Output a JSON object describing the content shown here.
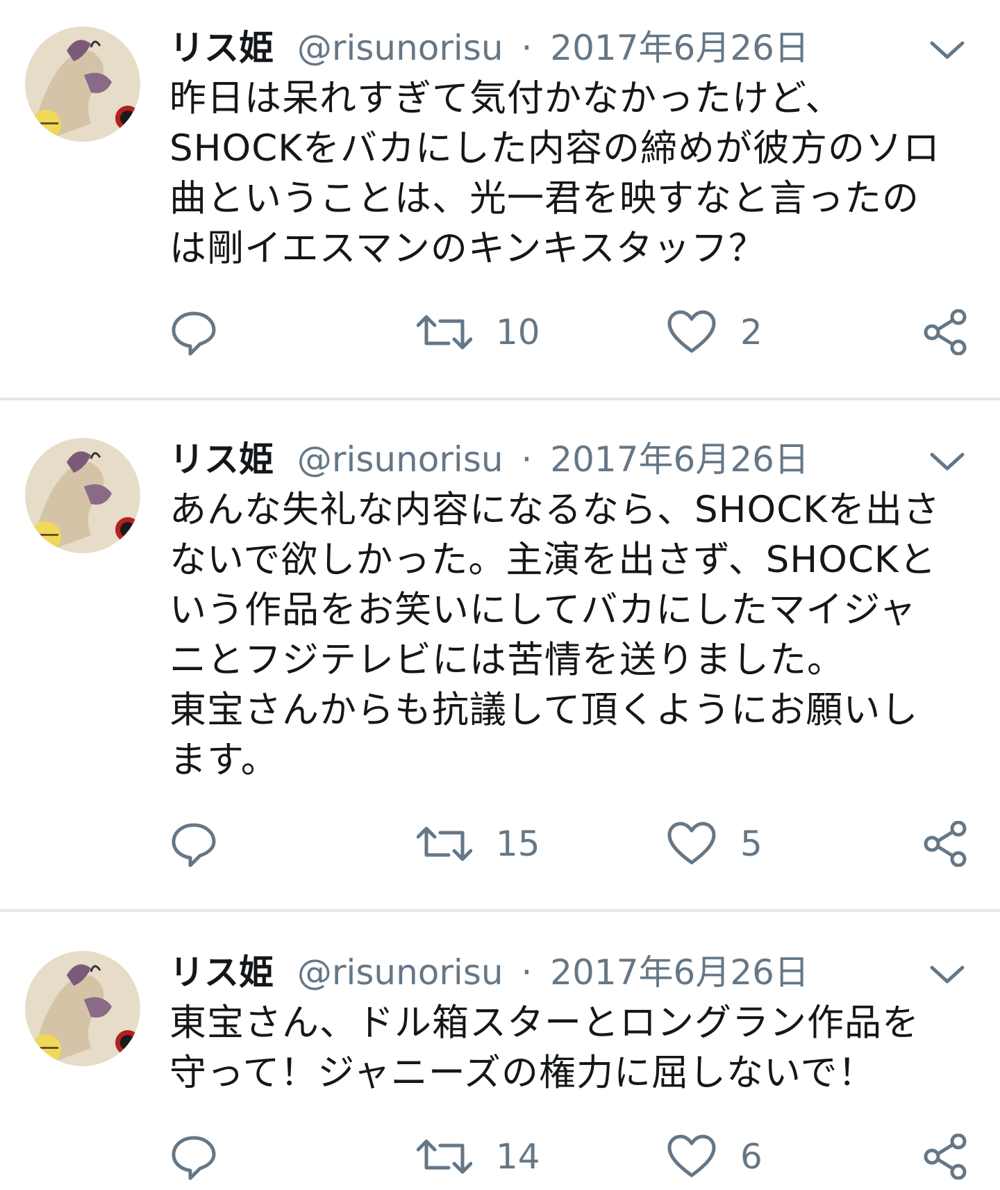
{
  "tweets": [
    {
      "author": {
        "name": "リス姫",
        "handle": "@risunorisu"
      },
      "separator": "·",
      "date": "2017年6月26日",
      "text_lines": [
        "昨日は呆れすぎて気付かなかったけど、",
        "SHOCKをバカにした内容の締めが彼方のソロ",
        "曲ということは、光一君を映すなと言ったの",
        "は剛イエスマンのキンキスタッフ？"
      ],
      "retweets": "10",
      "likes": "2"
    },
    {
      "author": {
        "name": "リス姫",
        "handle": "@risunorisu"
      },
      "separator": "·",
      "date": "2017年6月26日",
      "text_lines": [
        "あんな失礼な内容になるなら、SHOCKを出さ",
        "ないで欲しかった。主演を出さず、SHOCKと",
        "いう作品をお笑いにしてバカにしたマイジャ",
        "ニとフジテレビには苦情を送りました。",
        "東宝さんからも抗議して頂くようにお願いし",
        "ます。"
      ],
      "retweets": "15",
      "likes": "5"
    },
    {
      "author": {
        "name": "リス姫",
        "handle": "@risunorisu"
      },
      "separator": "·",
      "date": "2017年6月26日",
      "text_lines": [
        "東宝さん、ドル箱スターとロングラン作品を",
        "守って！ジャニーズの権力に屈しないで！"
      ],
      "retweets": "14",
      "likes": "6"
    }
  ],
  "icons": {
    "reply": "speech-bubble-icon",
    "retweet": "retweet-arrows-icon",
    "like": "heart-outline-icon",
    "share": "share-nodes-icon",
    "menu": "chevron-down-icon"
  },
  "colors": {
    "text_primary": "#14171a",
    "text_secondary": "#657786",
    "divider": "#e1e8ed",
    "icon": "#657786"
  }
}
